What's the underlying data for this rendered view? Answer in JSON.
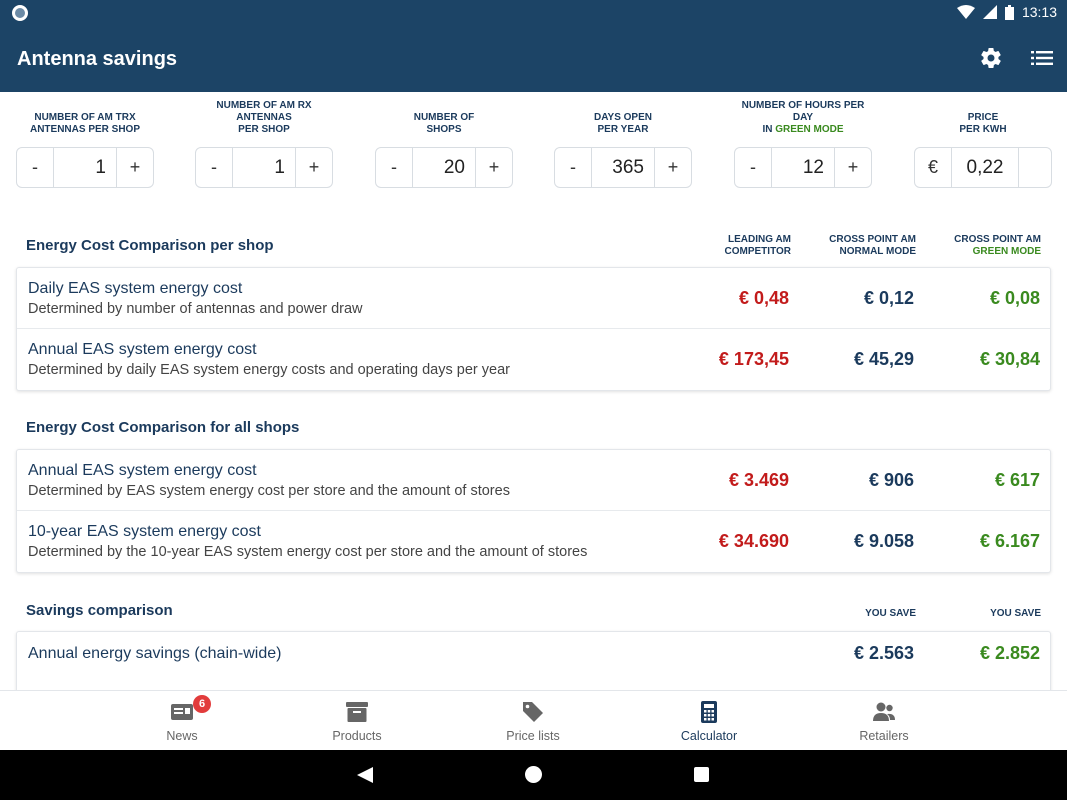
{
  "status": {
    "time": "13:13"
  },
  "app": {
    "title": "Antenna savings",
    "icons": [
      "settings-gear-icon",
      "list-icon"
    ]
  },
  "params": [
    {
      "label_lines": [
        "NUMBER OF AM TRX",
        "ANTENNAS PER SHOP"
      ],
      "value": "1"
    },
    {
      "label_lines": [
        "NUMBER OF AM RX",
        "ANTENNAS",
        "PER SHOP"
      ],
      "value": "1"
    },
    {
      "label_lines": [
        "NUMBER OF",
        "SHOPS"
      ],
      "value": "20"
    },
    {
      "label_lines": [
        "DAYS OPEN",
        "PER YEAR"
      ],
      "value": "365"
    },
    {
      "label_lines": [
        "NUMBER OF HOURS PER DAY"
      ],
      "label_green_prefix": "IN ",
      "label_green": "GREEN MODE",
      "value": "12"
    },
    {
      "label_lines": [
        "PRICE",
        "PER KWH"
      ],
      "currency": "€",
      "value": "0,22"
    }
  ],
  "stepper": {
    "minus": "-",
    "plus": "+"
  },
  "columns": {
    "c1": [
      "LEADING AM",
      "COMPETITOR"
    ],
    "c2": [
      "CROSS POINT AM",
      "NORMAL MODE"
    ],
    "c3": [
      "CROSS POINT AM"
    ],
    "c3_green": "GREEN MODE",
    "you_save": "YOU SAVE"
  },
  "sections": {
    "per_shop": {
      "title": "Energy Cost Comparison per shop",
      "rows": [
        {
          "title": "Daily EAS system energy cost",
          "sub": "Determined by number of antennas and power draw",
          "v1": "€ 0,48",
          "v2": "€ 0,12",
          "v3": "€ 0,08"
        },
        {
          "title": "Annual EAS system energy cost",
          "sub": "Determined by daily EAS system energy costs and operating days per year",
          "v1": "€ 173,45",
          "v2": "€ 45,29",
          "v3": "€ 30,84"
        }
      ]
    },
    "all_shops": {
      "title": "Energy Cost Comparison for all shops",
      "rows": [
        {
          "title": "Annual EAS system energy cost",
          "sub": "Determined by EAS system energy cost per store and the amount of stores",
          "v1": "€ 3.469",
          "v2": "€ 906",
          "v3": "€ 617"
        },
        {
          "title": "10-year EAS system energy cost",
          "sub": "Determined by the 10-year EAS system energy cost per store and the amount of stores",
          "v1": "€ 34.690",
          "v2": "€ 9.058",
          "v3": "€ 6.167"
        }
      ]
    },
    "savings": {
      "title": "Savings comparison",
      "rows": [
        {
          "title": "Annual energy savings (chain-wide)",
          "v2": "€ 2.563",
          "v3": "€ 2.852"
        }
      ]
    }
  },
  "nav": {
    "items": [
      {
        "label": "News",
        "badge": "6"
      },
      {
        "label": "Products"
      },
      {
        "label": "Price lists"
      },
      {
        "label": "Calculator",
        "active": true
      },
      {
        "label": "Retailers"
      }
    ]
  },
  "colors": {
    "primary": "#1c4466",
    "red": "#c21b1b",
    "green": "#3a8a1f",
    "navy": "#1b3a5c"
  }
}
